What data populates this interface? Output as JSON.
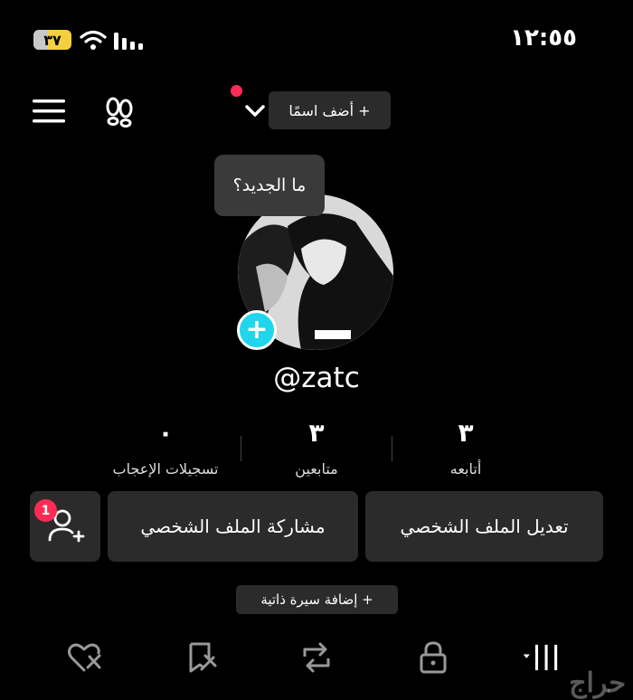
{
  "status_bar": {
    "battery_level": "٣٧",
    "battery_fraction": 0.37,
    "time": "١٢:٥٥"
  },
  "header": {
    "add_name_label": "+ أضف اسمًا"
  },
  "profile": {
    "bubble_text": "ما الجديد؟",
    "username": "@zatc"
  },
  "stats": [
    {
      "value": "٣",
      "label": "أتابعه"
    },
    {
      "value": "٣",
      "label": "متابعين"
    },
    {
      "value": "٠",
      "label": "تسجيلات الإعجاب"
    }
  ],
  "actions": {
    "edit_profile": "تعديل الملف الشخصي",
    "share_profile": "مشاركة الملف الشخصي",
    "friend_requests_count": "1"
  },
  "bio": {
    "add_bio_label": "+ إضافة سيرة ذاتية"
  },
  "tabs": [
    {
      "icon": "grid-icon"
    },
    {
      "icon": "lock-icon"
    },
    {
      "icon": "repost-icon"
    },
    {
      "icon": "favorites-icon"
    },
    {
      "icon": "liked-icon"
    }
  ],
  "watermark": "حراج",
  "colors": {
    "accent_red": "#fe2c55",
    "accent_cyan": "#20d5ec",
    "battery": "#f4d03f"
  }
}
